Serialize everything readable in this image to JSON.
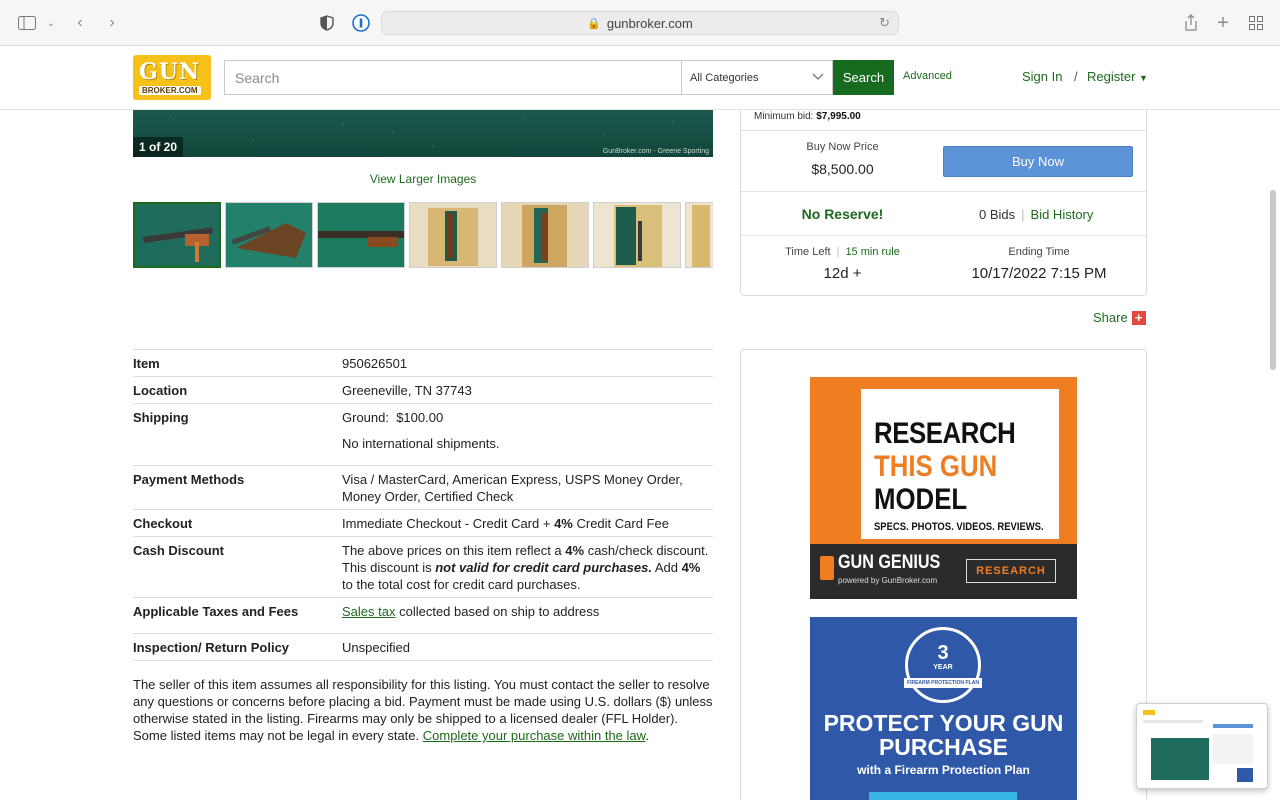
{
  "browser": {
    "url": "gunbroker.com"
  },
  "header": {
    "logo_top": "GUN",
    "logo_bottom": "BROKER.COM",
    "search_placeholder": "Search",
    "category": "All Categories",
    "search_label": "Search",
    "advanced_label": "Advanced",
    "signin_label": "Sign In",
    "slash": "/",
    "register_label": "Register"
  },
  "gallery": {
    "counter": "1 of 20",
    "watermark": "GunBroker.com - Greene Sporting",
    "view_larger": "View Larger Images"
  },
  "bid": {
    "min_bid_label": "Minimum bid:",
    "min_bid_value": "$7,995.00",
    "buy_now_price_label": "Buy Now Price",
    "buy_now_price": "$8,500.00",
    "buy_now_button": "Buy Now",
    "no_reserve": "No Reserve!",
    "bids_count": "0 Bids",
    "bid_history": "Bid History",
    "time_left_label": "Time Left",
    "rule_label": "15 min rule",
    "time_left_value": "12d +",
    "ending_time_label": "Ending Time",
    "ending_time_value": "10/17/2022 7:15 PM",
    "share_label": "Share",
    "share_plus": "+"
  },
  "details": {
    "item_k": "Item",
    "item_v": "950626501",
    "location_k": "Location",
    "location_v": "Greeneville, TN 37743",
    "shipping_k": "Shipping",
    "shipping_v1": "Ground:  $100.00",
    "shipping_v2": "No international shipments.",
    "payment_k": "Payment Methods",
    "payment_v": "Visa / MasterCard, American Express, USPS Money Order, Money Order, Certified Check",
    "checkout_k": "Checkout",
    "checkout_v1": "Immediate Checkout - Credit Card + ",
    "checkout_pct": "4%",
    "checkout_v2": " Credit Card Fee",
    "cash_k": "Cash Discount",
    "cash_v1": "The above prices on this item reflect a ",
    "cash_pct1": "4%",
    "cash_v2": " cash/check discount. This discount is ",
    "cash_em": "not valid for credit card purchases.",
    "cash_v3": " Add ",
    "cash_pct2": "4%",
    "cash_v4": " to the total cost for credit card purchases.",
    "taxes_k": "Applicable Taxes and Fees",
    "taxes_link": "Sales tax",
    "taxes_v": " collected based on ship to address",
    "inspection_k": "Inspection/ Return Policy",
    "inspection_v": "Unspecified"
  },
  "disclaimer": {
    "text": "The seller of this item assumes all responsibility for this listing. You must contact the seller to resolve any questions or concerns before placing a bid. Payment must be made using U.S. dollars ($) unless otherwise stated in the listing. Firearms may only be shipped to a licensed dealer (FFL Holder). Some listed items may not be legal in every state. ",
    "link": "Complete your purchase within the law",
    "end": "."
  },
  "ads": {
    "ad1_line1": "RESEARCH",
    "ad1_line2": "THIS GUN",
    "ad1_line3": "MODEL",
    "ad1_line4": "SPECS. PHOTOS. VIDEOS. REVIEWS.",
    "ad1_brand": "GUN GENIUS",
    "ad1_brand_sub": "powered by GunBroker.com",
    "ad1_button": "RESEARCH",
    "ad2_badge_num": "3",
    "ad2_badge_year": "YEAR",
    "ad2_badge_plan": "FIREARM PROTECTION PLAN",
    "ad2_headline": "PROTECT YOUR GUN PURCHASE",
    "ad2_sub": "with a Firearm Protection Plan"
  },
  "colors": {
    "brand_green": "#176b1f",
    "buy_now_blue": "#5b93d6",
    "logo_yellow": "#f6c21a",
    "ad_orange": "#ef7d22",
    "ad_blue": "#2f59a8"
  }
}
